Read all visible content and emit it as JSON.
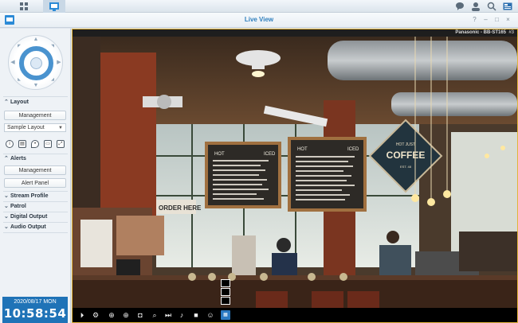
{
  "taskbar": {
    "icons": [
      "apps-grid-icon",
      "surveillance-live-view-icon",
      "chat-icon",
      "user-icon",
      "search-icon",
      "widgets-icon"
    ]
  },
  "window": {
    "title": "Live View",
    "controls": [
      "help-icon",
      "minimize-icon",
      "maximize-icon",
      "close-icon"
    ]
  },
  "sidebar": {
    "layout": {
      "header": "Layout",
      "management_label": "Management",
      "layout_select_value": "Sample Layout",
      "tool_icons": [
        "info-icon",
        "snapshot-icon",
        "map-pin-icon",
        "stream-icon",
        "fullscreen-icon"
      ]
    },
    "alerts": {
      "header": "Alerts",
      "management_label": "Management",
      "panel_label": "Alert Panel"
    },
    "collapsed_sections": [
      "Stream Profile",
      "Patrol",
      "Digital Output",
      "Audio Output"
    ]
  },
  "clock": {
    "date": "2020/08/17  MON",
    "time": "10:58:54"
  },
  "camera": {
    "name": "Panasonic - BB-ST165",
    "counter": "#3",
    "scene": {
      "sign_coffee_top": "HOT JUST",
      "sign_coffee_main": "COFFEE",
      "sign_coffee_bottom": "EST. 48",
      "board_left_title": "HOT",
      "board_left_title2": "ICED",
      "board_right_title": "HOT",
      "board_right_title2": "ICED",
      "order_sign": "ORDER HERE"
    }
  },
  "toolbar_icons": [
    "play-icon",
    "settings-icon",
    "zoom-in-icon",
    "add-icon",
    "snapshot-icon",
    "search-recording-icon",
    "skip-icon",
    "volume-icon",
    "record-icon",
    "talk-icon",
    "layout-icon"
  ],
  "colors": {
    "accent": "#2b8ad6",
    "clock_bg": "#1f73b7",
    "viewer_border": "#e2b43a"
  }
}
